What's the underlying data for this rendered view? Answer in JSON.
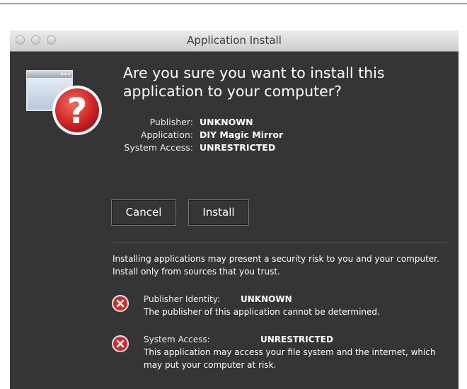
{
  "window": {
    "title": "Application Install"
  },
  "prompt": {
    "heading": "Are you sure you want to install this application to your computer?",
    "icon": "question-mark-app-icon"
  },
  "details": [
    {
      "label": "Publisher:",
      "value": "UNKNOWN"
    },
    {
      "label": "Application:",
      "value": "DIY Magic Mirror"
    },
    {
      "label": "System Access:",
      "value": "UNRESTRICTED"
    }
  ],
  "buttons": {
    "cancel": "Cancel",
    "install": "Install"
  },
  "warning": "Installing applications may present a security risk to you and your computer. Install only from sources that you trust.",
  "risks": [
    {
      "label": "Publisher Identity:",
      "value": "UNKNOWN",
      "description": "The publisher of this application cannot be determined.",
      "icon": "error-icon"
    },
    {
      "label": "System Access:",
      "value": "UNRESTRICTED",
      "description": "This application may access your file system and the internet, which may put your computer at risk.",
      "icon": "error-icon"
    }
  ],
  "colors": {
    "background": "#353535",
    "error_red": "#d42a2a",
    "text": "#ffffff"
  }
}
